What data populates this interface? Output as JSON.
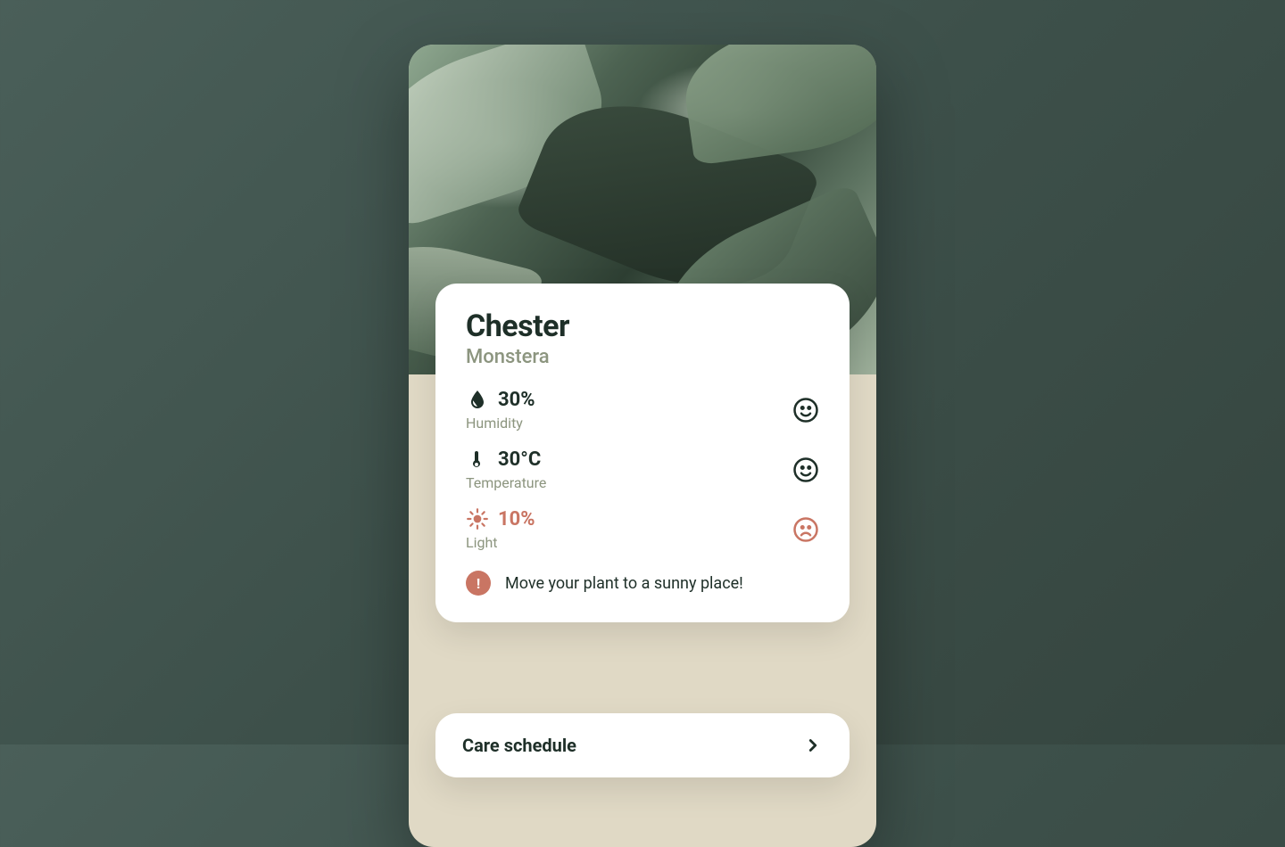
{
  "colors": {
    "text_dark": "#1e2f28",
    "text_muted": "#8c957f",
    "warn": "#c97563"
  },
  "plant": {
    "name": "Chester",
    "species": "Monstera"
  },
  "metrics": {
    "humidity": {
      "value": "30%",
      "label": "Humidity",
      "status": "happy"
    },
    "temperature": {
      "value": "30°C",
      "label": "Temperature",
      "status": "happy"
    },
    "light": {
      "value": "10%",
      "label": "Light",
      "status": "sad"
    }
  },
  "alert": {
    "message": "Move your plant to a sunny place!"
  },
  "schedule": {
    "title": "Care schedule"
  }
}
